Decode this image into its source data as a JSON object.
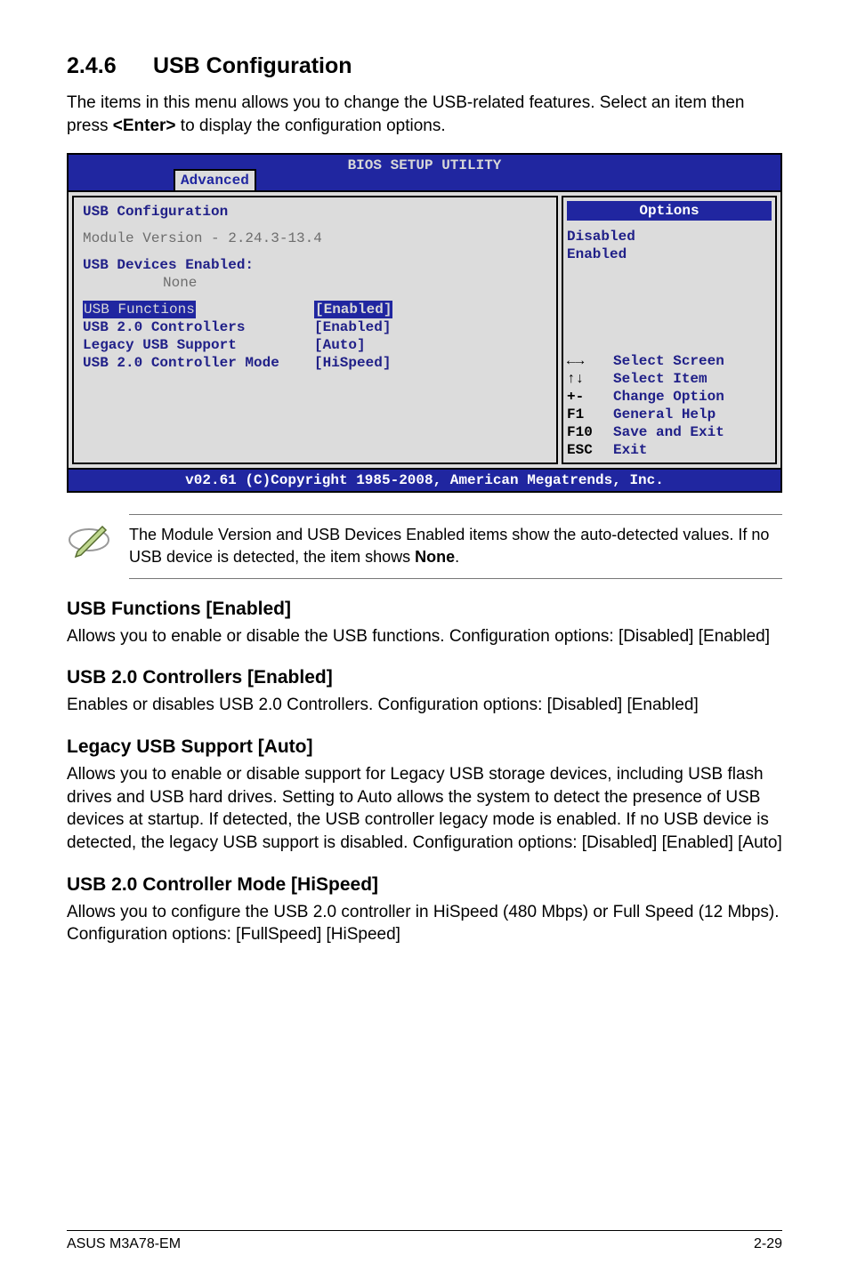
{
  "section": {
    "number": "2.4.6",
    "title": "USB Configuration"
  },
  "intro": "The items in this menu allows you to change the USB-related features. Select an item then press <Enter> to display the configuration options.",
  "bios": {
    "util_title": "BIOS SETUP UTILITY",
    "tab": "Advanced",
    "cfg_title": "USB Configuration",
    "module_version": "Module Version - 2.24.3-13.4",
    "devices_title": "USB Devices Enabled:",
    "devices_value": "None",
    "rows": [
      {
        "k": "USB Functions",
        "v": "[Enabled]",
        "selected": true
      },
      {
        "k": "USB 2.0 Controllers",
        "v": "[Enabled]",
        "selected": false
      },
      {
        "k": "Legacy USB Support",
        "v": "[Auto]",
        "selected": false
      },
      {
        "k": "USB 2.0 Controller Mode",
        "v": "[HiSpeed]",
        "selected": false
      }
    ],
    "options_hdr": "Options",
    "options": [
      "Disabled",
      "Enabled"
    ],
    "keys": [
      {
        "k": "←→",
        "v": "Select Screen"
      },
      {
        "k": "↑↓",
        "v": "Select Item"
      },
      {
        "k": "+-",
        "v": "Change Option"
      },
      {
        "k": "F1",
        "v": "General Help"
      },
      {
        "k": "F10",
        "v": "Save and Exit"
      },
      {
        "k": "ESC",
        "v": "Exit"
      }
    ],
    "footer": "v02.61 (C)Copyright 1985-2008, American Megatrends, Inc."
  },
  "note": "The Module Version and USB Devices Enabled items show the auto-detected values. If no USB device is detected, the item shows None.",
  "note_bold": "None",
  "sub": [
    {
      "title": "USB Functions [Enabled]",
      "body": "Allows you to enable or disable the USB functions. Configuration options: [Disabled] [Enabled]"
    },
    {
      "title": "USB 2.0 Controllers [Enabled]",
      "body": "Enables or disables USB 2.0 Controllers. Configuration options: [Disabled] [Enabled]"
    },
    {
      "title": "Legacy USB Support [Auto]",
      "body": "Allows you to enable or disable support for Legacy USB storage devices, including USB flash drives and USB hard drives. Setting to Auto allows the system to detect the presence of USB devices at startup. If detected, the USB controller legacy mode is enabled. If no USB device is detected, the legacy USB support is disabled. Configuration options: [Disabled] [Enabled] [Auto]"
    },
    {
      "title": "USB 2.0 Controller Mode [HiSpeed]",
      "body": "Allows you to configure the USB 2.0 controller in HiSpeed (480 Mbps) or Full Speed (12 Mbps). Configuration options: [FullSpeed] [HiSpeed]"
    }
  ],
  "page_footer": {
    "left": "ASUS M3A78-EM",
    "right": "2-29"
  }
}
